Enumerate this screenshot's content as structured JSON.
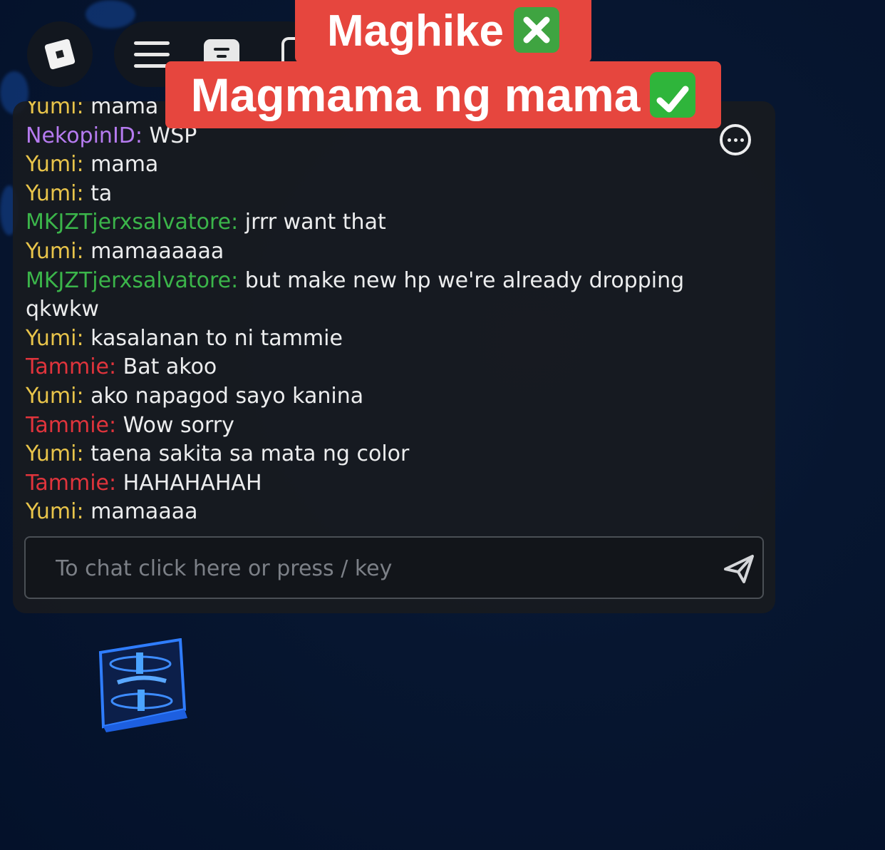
{
  "overlay": {
    "caption_top": "Maghike",
    "caption_top_icon": "cross-mark-icon",
    "caption_bottom": "Magmama ng mama",
    "caption_bottom_icon": "check-mark-icon"
  },
  "toolbar": {
    "roblox_icon": "roblox-logo-icon",
    "menu_icon": "hamburger-menu-icon",
    "chat_icon": "chat-bubble-icon",
    "emote_icon": "emote-icon"
  },
  "chat": {
    "more_icon": "more-options-icon",
    "messages": [
      {
        "speaker": "Yumi:",
        "text": " mama",
        "color": "#e8c44a"
      },
      {
        "speaker": "NekopinID:",
        "text": " WSP",
        "color": "#b67bf0"
      },
      {
        "speaker": "Yumi:",
        "text": " mama",
        "color": "#e8c44a"
      },
      {
        "speaker": "Yumi:",
        "text": " ta",
        "color": "#e8c44a"
      },
      {
        "speaker": "MKJZTjerxsalvatore:",
        "text": " jrrr want that",
        "color": "#3bb54a"
      },
      {
        "speaker": "Yumi:",
        "text": " mamaaaaaa",
        "color": "#e8c44a"
      },
      {
        "speaker": "MKJZTjerxsalvatore:",
        "text": " but make new hp we're already dropping qkwkw",
        "color": "#3bb54a"
      },
      {
        "speaker": "Yumi:",
        "text": " kasalanan to ni tammie",
        "color": "#e8c44a"
      },
      {
        "speaker": "Tammie:",
        "text": " Bat akoo",
        "color": "#e0343c"
      },
      {
        "speaker": "Yumi:",
        "text": " ako napagod sayo kanina",
        "color": "#e8c44a"
      },
      {
        "speaker": "Tammie:",
        "text": " Wow sorry",
        "color": "#e0343c"
      },
      {
        "speaker": "Yumi:",
        "text": " taena sakita sa mata ng color",
        "color": "#e8c44a"
      },
      {
        "speaker": "Tammie:",
        "text": " HAHAHAHAH",
        "color": "#e0343c"
      },
      {
        "speaker": "Yumi:",
        "text": " mamaaaa",
        "color": "#e8c44a"
      }
    ],
    "input": {
      "placeholder": "To chat click here or press / key",
      "value": "",
      "send_icon": "send-paper-plane-icon"
    }
  },
  "colors": {
    "caption_bg": "#e6463e",
    "chat_bg": "#181b1f",
    "world_bg": "#071630"
  }
}
